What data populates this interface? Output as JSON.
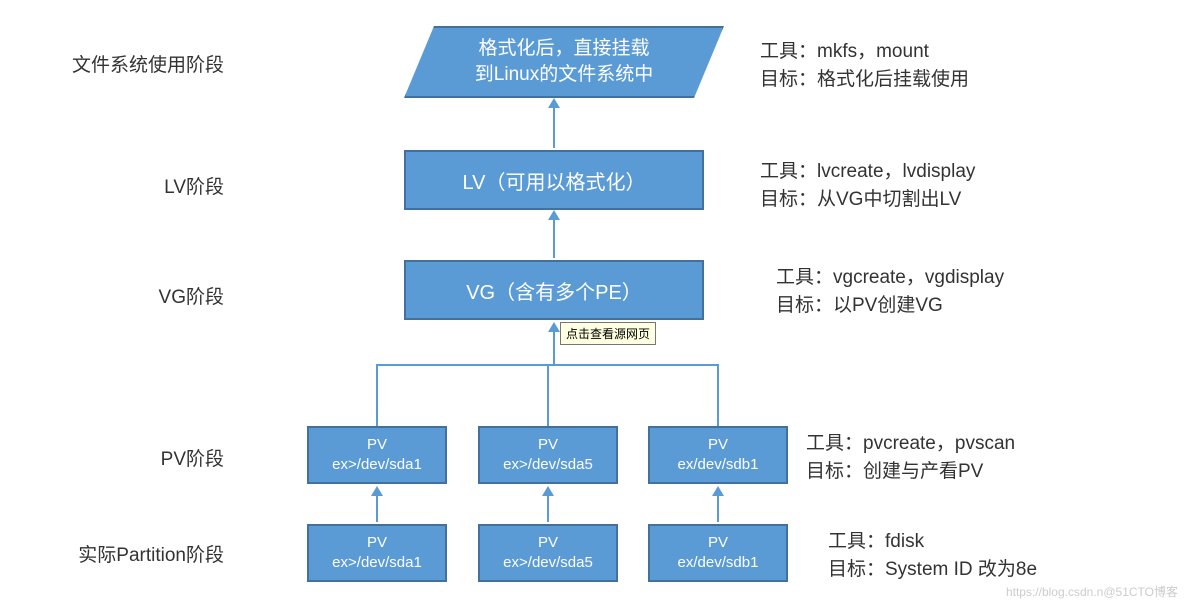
{
  "stages": {
    "fs": {
      "label": "文件系统使用阶段",
      "tools": "工具：mkfs，mount",
      "target": "目标：格式化后挂载使用"
    },
    "lv": {
      "label": "LV阶段",
      "tools": "工具：lvcreate，lvdisplay",
      "target": "目标：从VG中切割出LV"
    },
    "vg": {
      "label": "VG阶段",
      "tools": "工具：vgcreate，vgdisplay",
      "target": "目标：以PV创建VG"
    },
    "pv": {
      "label": "PV阶段",
      "tools": "工具：pvcreate，pvscan",
      "target": "目标：创建与产看PV"
    },
    "part": {
      "label": "实际Partition阶段",
      "tools": "工具：fdisk",
      "target": "目标：System ID 改为8e"
    }
  },
  "boxes": {
    "fs": {
      "line1": "格式化后，直接挂载",
      "line2": "到Linux的文件系统中"
    },
    "lv": {
      "text": "LV（可用以格式化）"
    },
    "vg": {
      "text": "VG（含有多个PE）"
    },
    "pv1": {
      "line1": "PV",
      "line2": "ex>/dev/sda1"
    },
    "pv2": {
      "line1": "PV",
      "line2": "ex>/dev/sda5"
    },
    "pv3": {
      "line1": "PV",
      "line2": "ex/dev/sdb1"
    },
    "part1": {
      "line1": "PV",
      "line2": "ex>/dev/sda1"
    },
    "part2": {
      "line1": "PV",
      "line2": "ex>/dev/sda5"
    },
    "part3": {
      "line1": "PV",
      "line2": "ex/dev/sdb1"
    }
  },
  "tooltip": "点击查看源网页",
  "watermark": "https://blog.csdn.n@51CTO博客"
}
